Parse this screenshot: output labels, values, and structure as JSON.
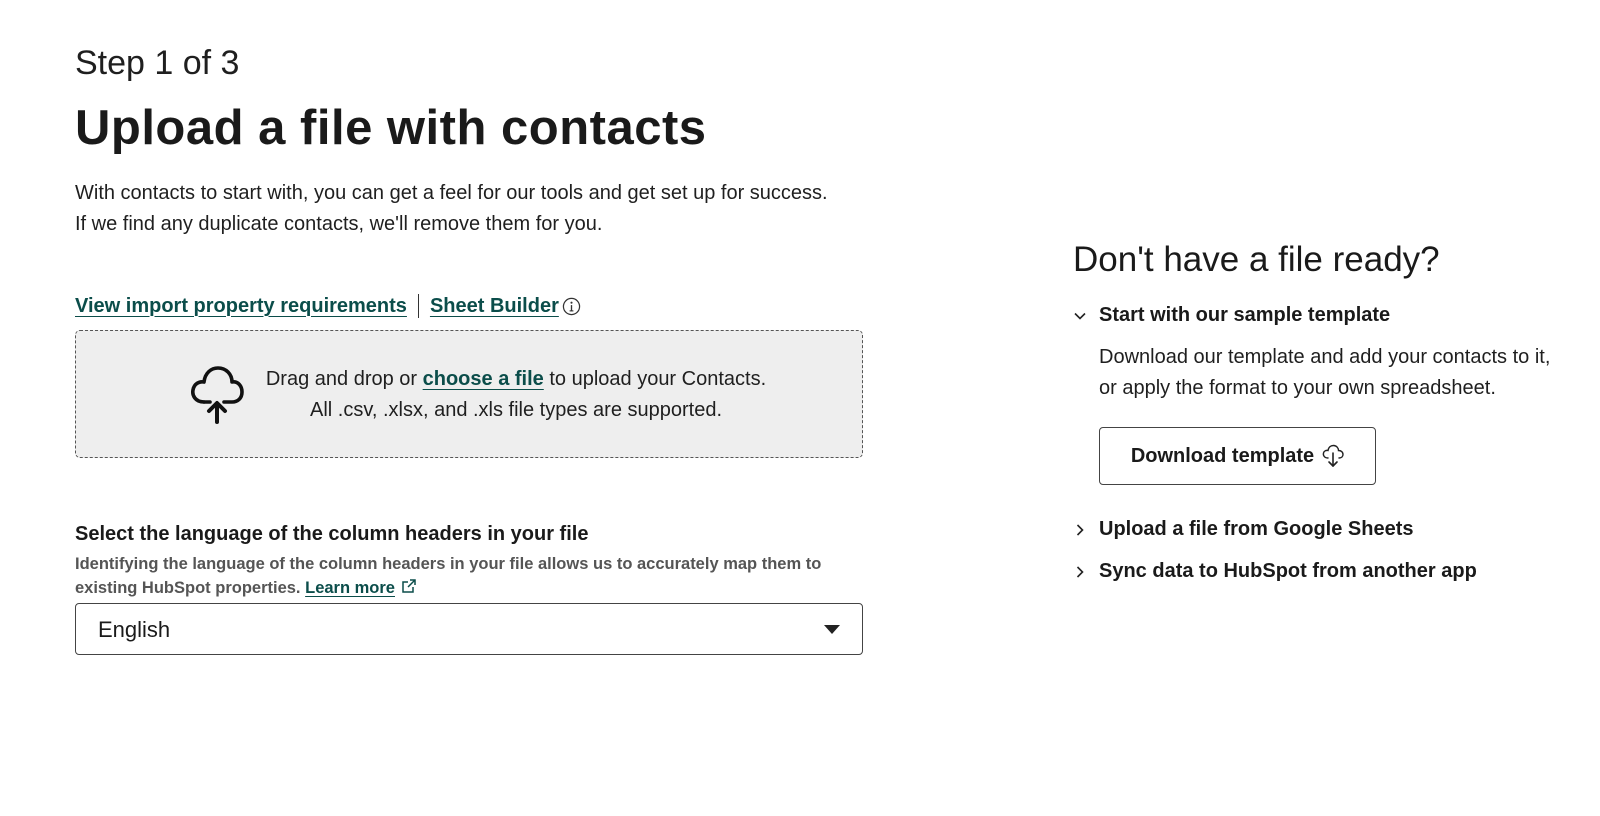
{
  "header": {
    "step": "Step 1 of 3",
    "title": "Upload a file with contacts",
    "intro_line1": "With contacts to start with, you can get a feel for our tools and get set up for success.",
    "intro_line2": "If we find any duplicate contacts, we'll remove them for you."
  },
  "links": {
    "requirements": "View import property requirements",
    "sheet_builder": "Sheet Builder"
  },
  "dropzone": {
    "prefix": "Drag and drop or ",
    "choose_link": "choose a file",
    "suffix": " to upload your Contacts.",
    "supported": "All .csv, .xlsx, and .xls file types are supported."
  },
  "language": {
    "label": "Select the language of the column headers in your file",
    "help": "Identifying the language of the column headers in your file allows us to accurately map them to existing HubSpot properties. ",
    "learn_more": "Learn more",
    "selected": "English"
  },
  "sidebar": {
    "title": "Don't have a file ready?",
    "sections": [
      {
        "label": "Start with our sample template",
        "expanded": true,
        "body": "Download our template and add your contacts to it, or apply the format to your own spreadsheet.",
        "button": "Download template"
      },
      {
        "label": "Upload a file from Google Sheets",
        "expanded": false
      },
      {
        "label": "Sync data to HubSpot from another app",
        "expanded": false
      }
    ]
  },
  "colors": {
    "link": "#0b4d4a",
    "dropzone_bg": "#eeeeee",
    "text": "#1f1f1f",
    "muted": "#555555"
  },
  "icons": [
    "info-icon",
    "cloud-upload-icon",
    "external-link-icon",
    "chevron-down-icon",
    "chevron-right-icon",
    "download-cloud-icon",
    "caret-down-icon"
  ]
}
